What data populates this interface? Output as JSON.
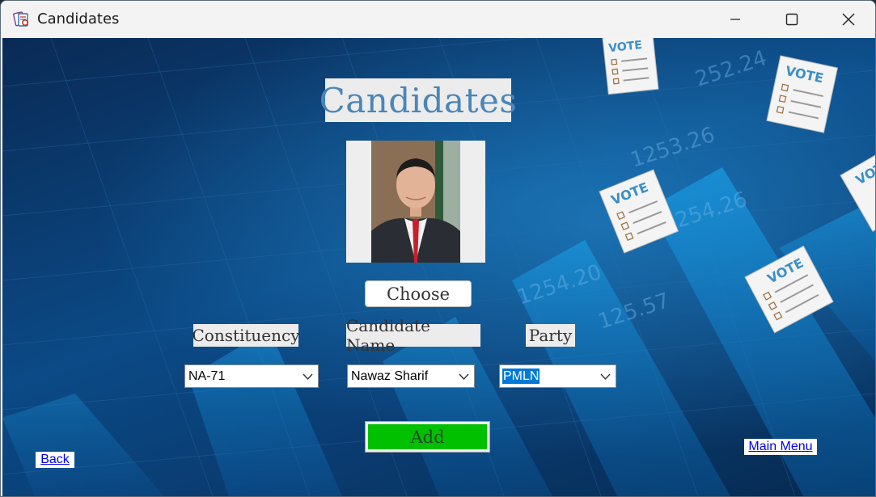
{
  "window": {
    "title": "Candidates",
    "controls": {
      "minimize": "minimize",
      "maximize": "maximize",
      "close": "close"
    }
  },
  "background": {
    "decor_numbers": [
      "1253.26",
      "1254.26",
      "1254.20",
      "125.57",
      "252.24"
    ],
    "vote_text": "VOTE"
  },
  "form": {
    "heading": "Candidates",
    "photo_alt": "candidate photo",
    "choose_label": "Choose",
    "labels": {
      "constituency": "Constituency",
      "candidate_name": "Candidate Name",
      "party": "Party"
    },
    "fields": {
      "constituency": "NA-71",
      "candidate_name": "Nawaz Sharif",
      "party": "PMLN"
    },
    "add_label": "Add"
  },
  "nav": {
    "back": "Back",
    "main_menu": "Main Menu"
  },
  "colors": {
    "add_button": "#00c000",
    "heading_text": "#4a86b8",
    "link": "#0000ee",
    "selection": "#0078d7"
  }
}
